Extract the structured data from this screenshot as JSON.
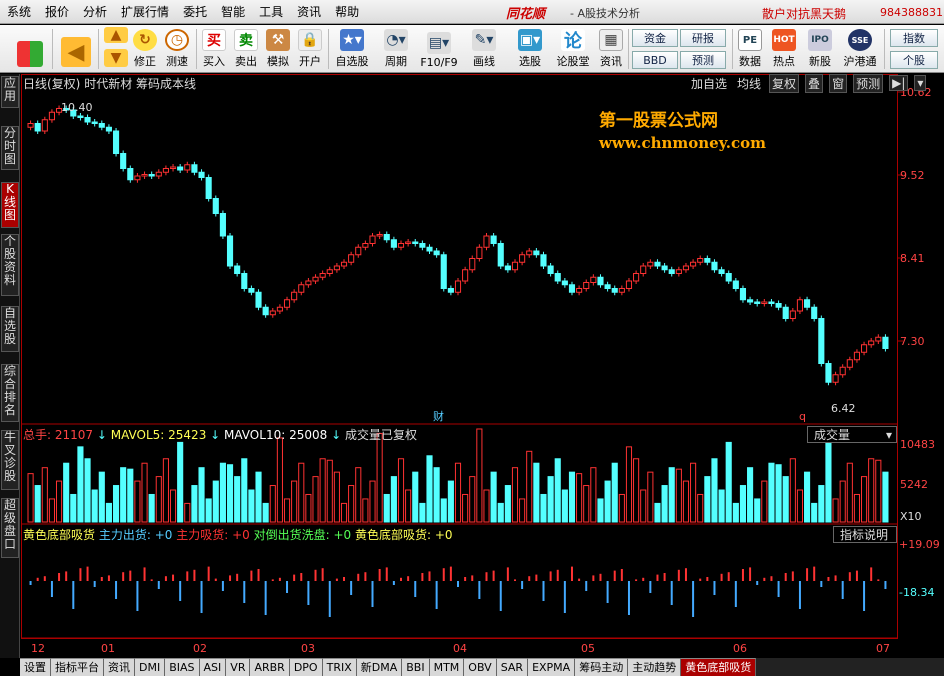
{
  "menu": [
    "系统",
    "报价",
    "分析",
    "扩展行情",
    "委托",
    "智能",
    "工具",
    "资讯",
    "帮助"
  ],
  "brand": "同花顺",
  "app_sub": "- A股技术分析",
  "slogan": "散户对抗黑天鹅",
  "phone": "984388831",
  "toolbar": {
    "buy_label": "买入",
    "sell_label": "卖出",
    "sim_label": "模拟",
    "open_label": "开户",
    "modify_label": "修正",
    "speed_label": "测速",
    "selfselect_label": "自选股",
    "period_label": "周期",
    "f10_label": "F10/F9",
    "draw_label": "画线",
    "pick_label": "选股",
    "forum_label": "论股堂",
    "info_label": "资讯",
    "fund_label": "资金",
    "bbd_label": "BBD",
    "research_label": "研报",
    "forecast_label": "预测",
    "data_label": "数据",
    "hot_label": "热点",
    "newstock_label": "新股",
    "hk_label": "沪港通",
    "index_label": "指数",
    "stock_label": "个股"
  },
  "sidebar": [
    "应用",
    "分时图",
    "K线图",
    "个股资料",
    "自选股",
    "综合排名",
    "牛叉诊股",
    "超级盘口"
  ],
  "price_header": {
    "title": "日线(复权)",
    "name": "时代新材",
    "indicator": "筹码成本线"
  },
  "price_tools": [
    "加自选",
    "均线",
    "复权",
    "叠",
    "窗",
    "预测"
  ],
  "watermark": {
    "line1": "第一股票公式网",
    "line2": "www.chnmoney.com"
  },
  "price_axis": [
    "10.62",
    "9.52",
    "8.41",
    "7.30"
  ],
  "high_label": "10.40",
  "low_label": "6.42",
  "cai_label": "财",
  "q_label": "q",
  "vol_header": {
    "total": "总手: 21107",
    "mavol5": "MAVOL5: 25423",
    "mavol10": "MAVOL10: 25008",
    "note": "成交量已复权"
  },
  "vol_button": "成交量",
  "vol_axis": [
    "10483",
    "5242",
    "X10"
  ],
  "ind_header": {
    "name": "黄色底部吸货",
    "main_out": "主力出货: +0",
    "main_in": "主力吸货: +0",
    "counter": "对倒出货洗盘: +0",
    "yellow": "黄色底部吸货: +0"
  },
  "ind_button": "指标说明",
  "ind_axis": [
    "+19.09",
    "-18.34"
  ],
  "x_axis": [
    "12",
    "01",
    "02",
    "03",
    "04",
    "05",
    "06",
    "07"
  ],
  "bottom_tabs": [
    "设置",
    "指标平台",
    "资讯",
    "DMI",
    "BIAS",
    "ASI",
    "VR",
    "ARBR",
    "DPO",
    "TRIX",
    "新DMA",
    "BBI",
    "MTM",
    "OBV",
    "SAR",
    "EXPMA",
    "筹码主动",
    "主动趋势",
    "黄色底部吸货"
  ],
  "colors": {
    "up": "#ff3232",
    "down": "#54ffff",
    "accent": "#c00"
  }
}
